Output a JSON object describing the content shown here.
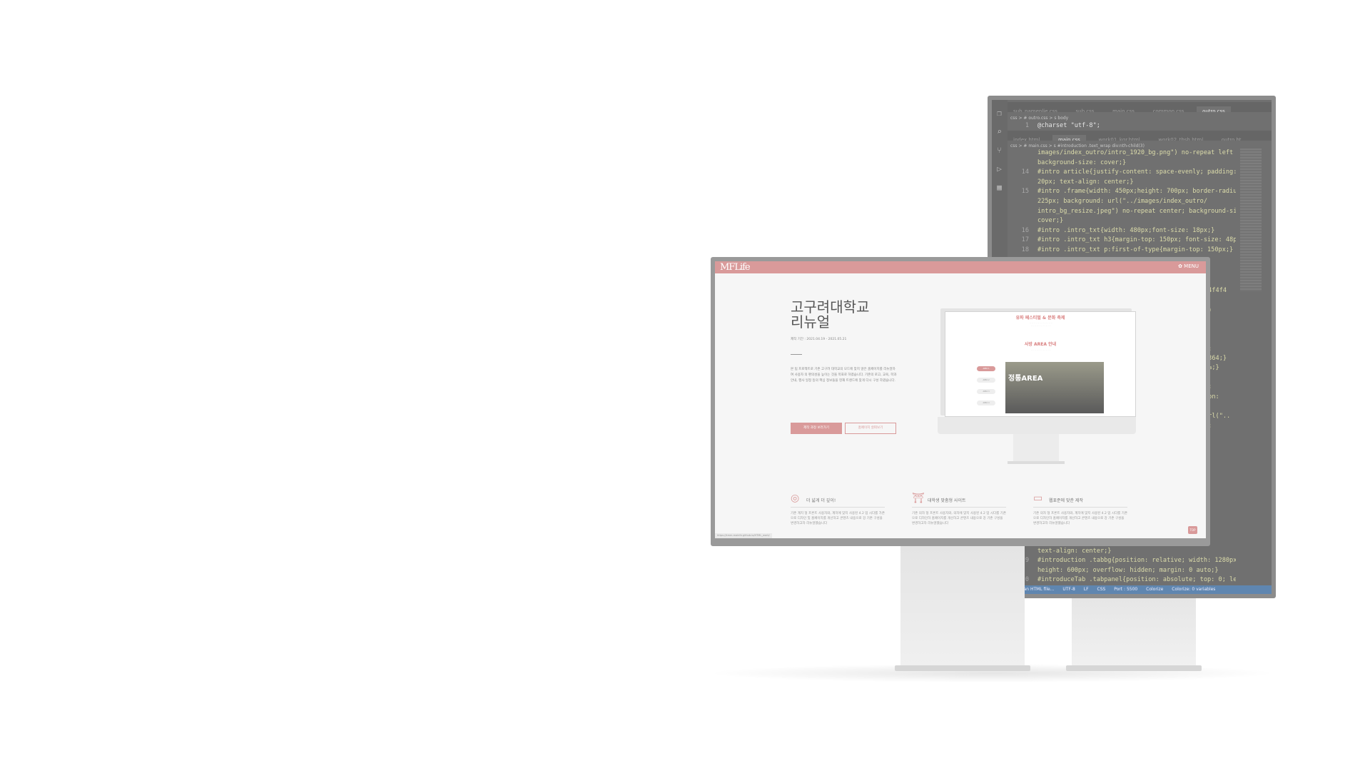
{
  "editor": {
    "tabs_top": [
      "sub_namenlie.css",
      "sub.css",
      "main.css",
      "common.css",
      "outro.css"
    ],
    "tabs_second": [
      "index.html",
      "main.css",
      "work01_kgr.html",
      "work02_thsh.html",
      "outro.ht"
    ],
    "crumb_top": "css > # outro.css > ꜱ body",
    "charset_line": "@charset \"utf-8\";",
    "crumb_second": "css > # main.css > ꜱ #introduction .text_wrap div:nth-child(3)",
    "code_lines": [
      {
        "ln": "",
        "text": "images/index_outro/intro_1920_bg.png\") no-repeat left top;"
      },
      {
        "ln": "",
        "text": "background-size: cover;}"
      },
      {
        "ln": "14",
        "text": "#intro article{justify-content: space-evenly; padding: 150px"
      },
      {
        "ln": "",
        "text": "20px; text-align: center;}"
      },
      {
        "ln": "15",
        "text": "#intro .frame{width: 450px;height: 700px; border-radius:"
      },
      {
        "ln": "",
        "text": "225px; background: url(\"../images/index_outro/"
      },
      {
        "ln": "",
        "text": "intro_bg_resize.jpeg\") no-repeat center; background-size:"
      },
      {
        "ln": "",
        "text": "cover;}"
      },
      {
        "ln": "16",
        "text": "#intro .intro_txt{width: 480px;font-size: 18px;}"
      },
      {
        "ln": "17",
        "text": "#intro .intro_txt h3{margin-top: 150px; font-size: 48px;}"
      },
      {
        "ln": "18",
        "text": "#intro .intro_txt p:first-of-type{margin-top: 150px;}"
      }
    ],
    "peek_lines": [
      "f4f4f4",
      ";)",
      "n:",
      "4364;}",
      "0%;}",
      ";",
      "x;",
      "ion:",
      "url(\"..",
      "r;"
    ],
    "bottom_lines": [
      {
        "ln": "",
        "text": "ter;"
      },
      {
        "ln": "",
        "text": "text-align: center;}"
      },
      {
        "ln": "9",
        "text": "#introduction .tabbg{position: relative; width: 1280px;"
      },
      {
        "ln": "",
        "text": "height: 600px; overflow: hidden; margin: 0 auto;}"
      },
      {
        "ln": "0",
        "text": "#introduceTab .tabpanel{position: absolute; top: 0; left: 0;"
      }
    ],
    "status": [
      "Waiting for an HTML file...",
      "UTF-8",
      "LF",
      "CSS",
      "Port : 5500",
      "Colorize",
      "Colorize: 0 variables"
    ]
  },
  "site": {
    "logo": "MFLife",
    "menu": "MENU",
    "title_line1": "고구려대학교",
    "title_line2": "리뉴얼",
    "period": "제작 기간 : 2021.04.19 - 2021.05.21",
    "description": "본 팀 프로젝트로 기존 고구려 대학교의 모드에 맞지 않은 홈페이지를 리뉴얼하여 사용자 의 편의성을 높이는 것을 목표로 하였습니다. 기존의 로고, 교육, 학과 안내, 행사 일정 등의 핵심 정보들을 현재 트렌드에 맞게 다시 구성 하였습니다.",
    "btn_primary": "제작 과정 보러가기",
    "btn_outline": "홈페이지 살펴보기",
    "mini": {
      "heading1": "유파 페스티벌 & 문화 축제",
      "heading2": "사방 AREA 안내",
      "pills": [
        "AREA 1",
        "AREA 2",
        "AREA 3",
        "AREA 4"
      ],
      "crowd_title": "정통AREA"
    },
    "features": [
      {
        "icon": "target-icon",
        "title": "더 넓게 더 깊이!",
        "desc": "기존 계치 형 프론트 사용자와, 계치에 맞지 사용된 4.2 업 시다를 가존으로 디자인 및 홈페이지를 개선하고 콘텐츠 내용으로 강 기존 구성을 변경하고자 리뉴얼했습니다"
      },
      {
        "icon": "building-icon",
        "title": "대학생 맞춤형 사이트",
        "desc": "기존 의자 형 프론트 사용자와, 의자에 맞지 사용된 4.2 업 시다를 기존으로 디자인하 홈페이지를 개선하고 콘텐츠 내용으로 강 기존 구성을 변경하고자 리뉴얼했습니다"
      },
      {
        "icon": "browser-icon",
        "title": "웹표준에 맞춘 제작",
        "desc": "기존 의자 형 프론트 사용자와, 계치에 맞지 사용된 4.2 업 시다를 기존으로 디자인하 홈페이지를 개선하고 콘텐츠 내용으로 강 기존 구성을 변경하고자 리뉴얼했습니다"
      }
    ],
    "status_url": "https://kmm-mainfe.github.io/HTML_work/",
    "top_button": "TOP"
  }
}
